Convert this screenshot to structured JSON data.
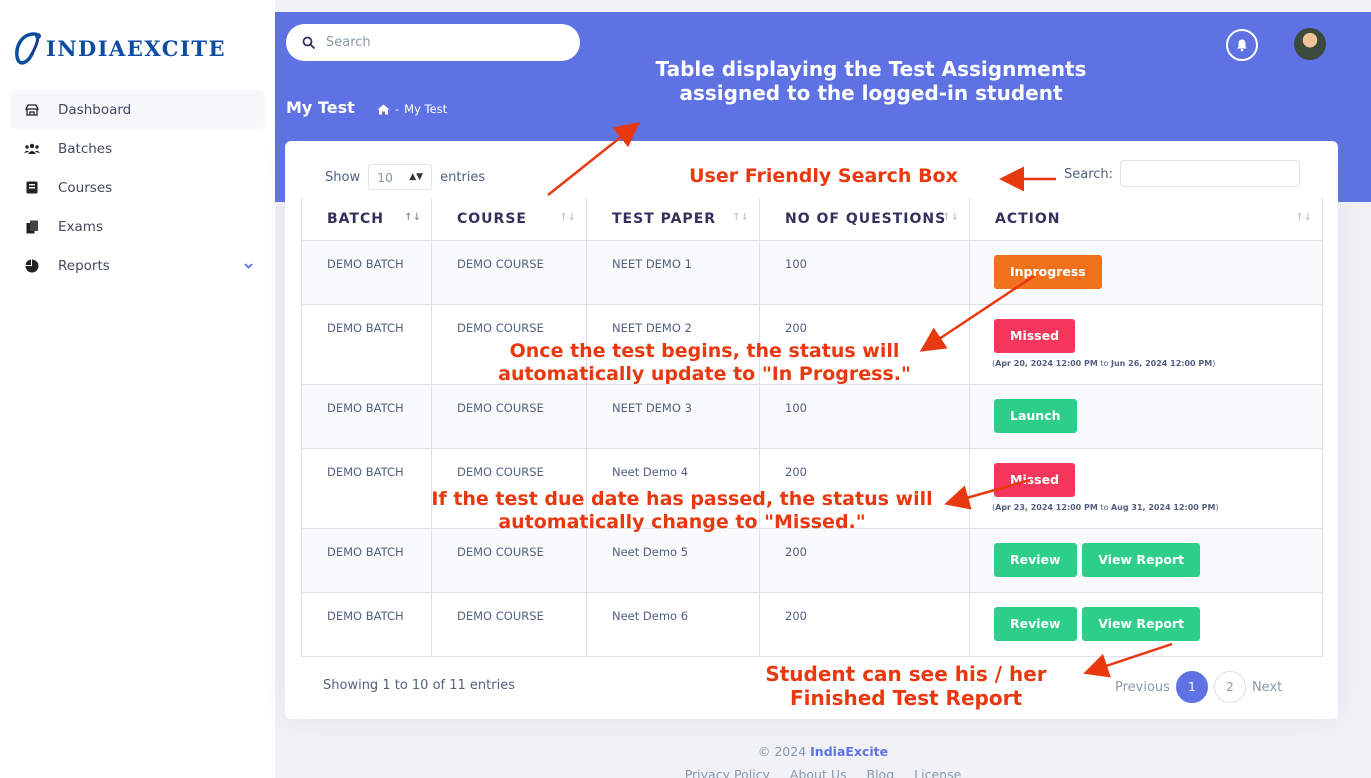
{
  "brand": {
    "logo_text": "INDIAEXCITE"
  },
  "sidebar": {
    "items": [
      {
        "label": "Dashboard",
        "icon": "dashboard-icon"
      },
      {
        "label": "Batches",
        "icon": "users-icon"
      },
      {
        "label": "Courses",
        "icon": "book-icon"
      },
      {
        "label": "Exams",
        "icon": "copy-icon"
      },
      {
        "label": "Reports",
        "icon": "pie-chart-icon"
      }
    ]
  },
  "header": {
    "search_placeholder": "Search",
    "page_title": "My Test",
    "breadcrumb": "My Test"
  },
  "table_controls": {
    "show_label": "Show",
    "entries_value": "10",
    "entries_label": "entries",
    "search_label": "Search:"
  },
  "table": {
    "columns": [
      "BATCH",
      "COURSE",
      "TEST PAPER",
      "NO OF QUESTIONS",
      "ACTION"
    ],
    "rows": [
      {
        "batch": "DEMO BATCH",
        "course": "DEMO COURSE",
        "paper": "NEET DEMO 1",
        "questions": "100",
        "action": "Inprogress"
      },
      {
        "batch": "DEMO BATCH",
        "course": "DEMO COURSE",
        "paper": "NEET DEMO 2",
        "questions": "200",
        "action": "Missed",
        "date_from": "Apr 20, 2024 12:00 PM",
        "date_to": "Jun 26, 2024 12:00 PM"
      },
      {
        "batch": "DEMO BATCH",
        "course": "DEMO COURSE",
        "paper": "NEET DEMO 3",
        "questions": "100",
        "action": "Launch"
      },
      {
        "batch": "DEMO BATCH",
        "course": "DEMO COURSE",
        "paper": "Neet Demo 4",
        "questions": "200",
        "action": "Missed",
        "date_from": "Apr 23, 2024 12:00 PM",
        "date_to": "Aug 31, 2024 12:00 PM"
      },
      {
        "batch": "DEMO BATCH",
        "course": "DEMO COURSE",
        "paper": "Neet Demo 5",
        "questions": "200",
        "action": "Review",
        "action2": "View Report"
      },
      {
        "batch": "DEMO BATCH",
        "course": "DEMO COURSE",
        "paper": "Neet Demo 6",
        "questions": "200",
        "action": "Review",
        "action2": "View Report"
      }
    ],
    "date_joiner": "to"
  },
  "pagination": {
    "info": "Showing 1 to 10 of 11 entries",
    "previous": "Previous",
    "pages": [
      "1",
      "2"
    ],
    "next": "Next"
  },
  "footer": {
    "copyright": "© 2024",
    "brand": "IndiaExcite",
    "links": [
      "Privacy Policy",
      "About Us",
      "Blog",
      "License"
    ]
  },
  "annotations": {
    "table_line1": "Table displaying the Test Assignments",
    "table_line2": "assigned to the logged-in student",
    "search_box": "User Friendly Search Box",
    "inprogress_line1": "Once the test begins, the status will",
    "inprogress_line2": "automatically update to \"In Progress.\"",
    "missed_line1": "If the test due date has passed, the status will",
    "missed_line2": "automatically change to \"Missed.\"",
    "report_line1": "Student can see his / her",
    "report_line2": "Finished Test Report"
  },
  "colors": {
    "primary": "#5e72e4",
    "inprogress": "#f2711c",
    "missed": "#f5365c",
    "success": "#2dce89",
    "annotation": "#e83810"
  }
}
